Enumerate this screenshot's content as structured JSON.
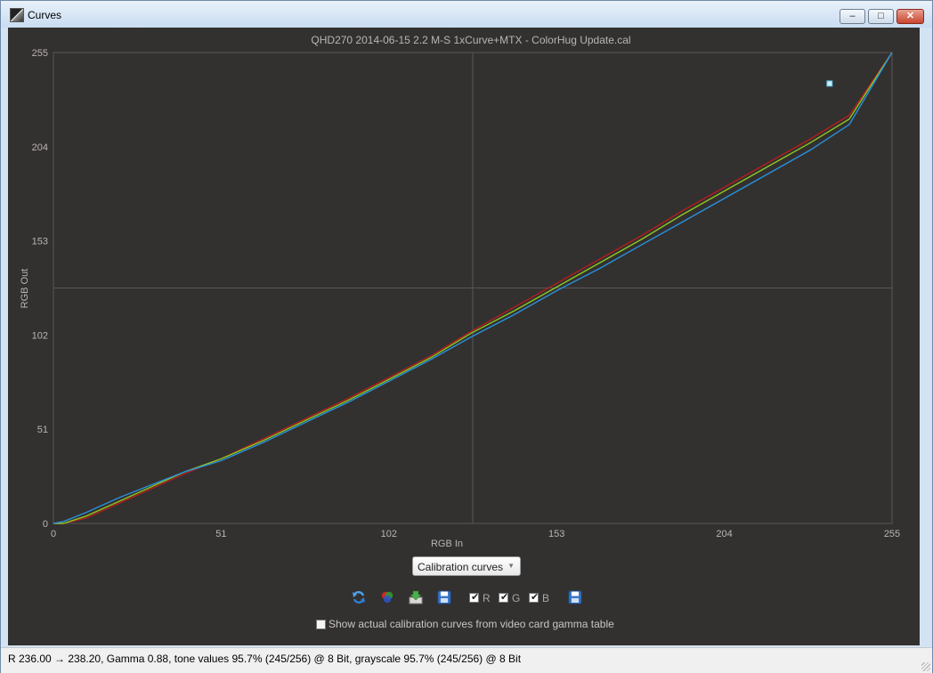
{
  "window": {
    "title": "Curves",
    "minimize_glyph": "–",
    "maximize_glyph": "□",
    "close_glyph": "✕"
  },
  "chart_data": {
    "type": "line",
    "title": "QHD270 2014-06-15 2.2 M-S 1xCurve+MTX - ColorHug Update.cal",
    "xlabel": "RGB In",
    "ylabel": "RGB Out",
    "xlim": [
      0,
      255
    ],
    "ylim": [
      0,
      255
    ],
    "xticks": [
      "0",
      "51",
      "102",
      "153",
      "204",
      "255"
    ],
    "yticks": [
      "0",
      "51",
      "102",
      "153",
      "204",
      "255"
    ],
    "grid": "center crosshair",
    "marker": {
      "x": 236,
      "y": 238.2
    },
    "series": [
      {
        "color": "#b41e1e",
        "points": [
          [
            0,
            0
          ],
          [
            3,
            0
          ],
          [
            10,
            3
          ],
          [
            20,
            11
          ],
          [
            30,
            19
          ],
          [
            40,
            27
          ],
          [
            51,
            35
          ],
          [
            64,
            46
          ],
          [
            77,
            57
          ],
          [
            90,
            68
          ],
          [
            102,
            79
          ],
          [
            115,
            91
          ],
          [
            127,
            104
          ],
          [
            140,
            117
          ],
          [
            153,
            130
          ],
          [
            166,
            143
          ],
          [
            179,
            156
          ],
          [
            191,
            169
          ],
          [
            204,
            182
          ],
          [
            217,
            195
          ],
          [
            230,
            208
          ],
          [
            242,
            221
          ],
          [
            255,
            255
          ]
        ]
      },
      {
        "color": "#8cc81e",
        "points": [
          [
            0,
            0
          ],
          [
            3,
            0
          ],
          [
            10,
            4
          ],
          [
            20,
            12
          ],
          [
            30,
            20
          ],
          [
            40,
            28
          ],
          [
            51,
            35
          ],
          [
            64,
            45
          ],
          [
            77,
            56
          ],
          [
            90,
            67
          ],
          [
            102,
            78
          ],
          [
            115,
            90
          ],
          [
            127,
            103
          ],
          [
            140,
            115
          ],
          [
            153,
            128
          ],
          [
            166,
            141
          ],
          [
            179,
            154
          ],
          [
            191,
            167
          ],
          [
            204,
            180
          ],
          [
            217,
            193
          ],
          [
            230,
            206
          ],
          [
            242,
            219
          ],
          [
            255,
            255
          ]
        ]
      },
      {
        "color": "#2892dc",
        "points": [
          [
            0,
            0
          ],
          [
            3,
            1
          ],
          [
            10,
            6
          ],
          [
            20,
            14
          ],
          [
            30,
            21
          ],
          [
            40,
            28
          ],
          [
            51,
            34
          ],
          [
            64,
            44
          ],
          [
            77,
            55
          ],
          [
            90,
            66
          ],
          [
            102,
            77
          ],
          [
            115,
            89
          ],
          [
            127,
            101
          ],
          [
            140,
            113
          ],
          [
            153,
            126
          ],
          [
            166,
            138
          ],
          [
            179,
            151
          ],
          [
            191,
            163
          ],
          [
            204,
            176
          ],
          [
            217,
            189
          ],
          [
            230,
            202
          ],
          [
            242,
            216
          ],
          [
            255,
            255
          ]
        ]
      }
    ]
  },
  "controls": {
    "curve_mode": "Calibration curves",
    "r_label": "R",
    "g_label": "G",
    "b_label": "B",
    "r_checked": true,
    "g_checked": true,
    "b_checked": true,
    "show_actual_label": "Show actual calibration curves from video card gamma table",
    "show_actual_checked": false
  },
  "status": {
    "text": "R 236.00 → 238.20, Gamma 0.88, tone values 95.7% (245/256) @ 8 Bit, grayscale 95.7% (245/256) @ 8 Bit"
  },
  "colors": {
    "plot_background": "#333030",
    "axis_text": "#b9b5b2",
    "red_curve": "#b41e1e",
    "green_curve": "#8cc81e",
    "blue_curve": "#2892dc"
  },
  "icons": {
    "title": "curves-app-icon",
    "toolbar": [
      "refresh-icon",
      "rgb-colors-icon",
      "load-icon",
      "save-icon",
      "save-icon-2"
    ]
  }
}
